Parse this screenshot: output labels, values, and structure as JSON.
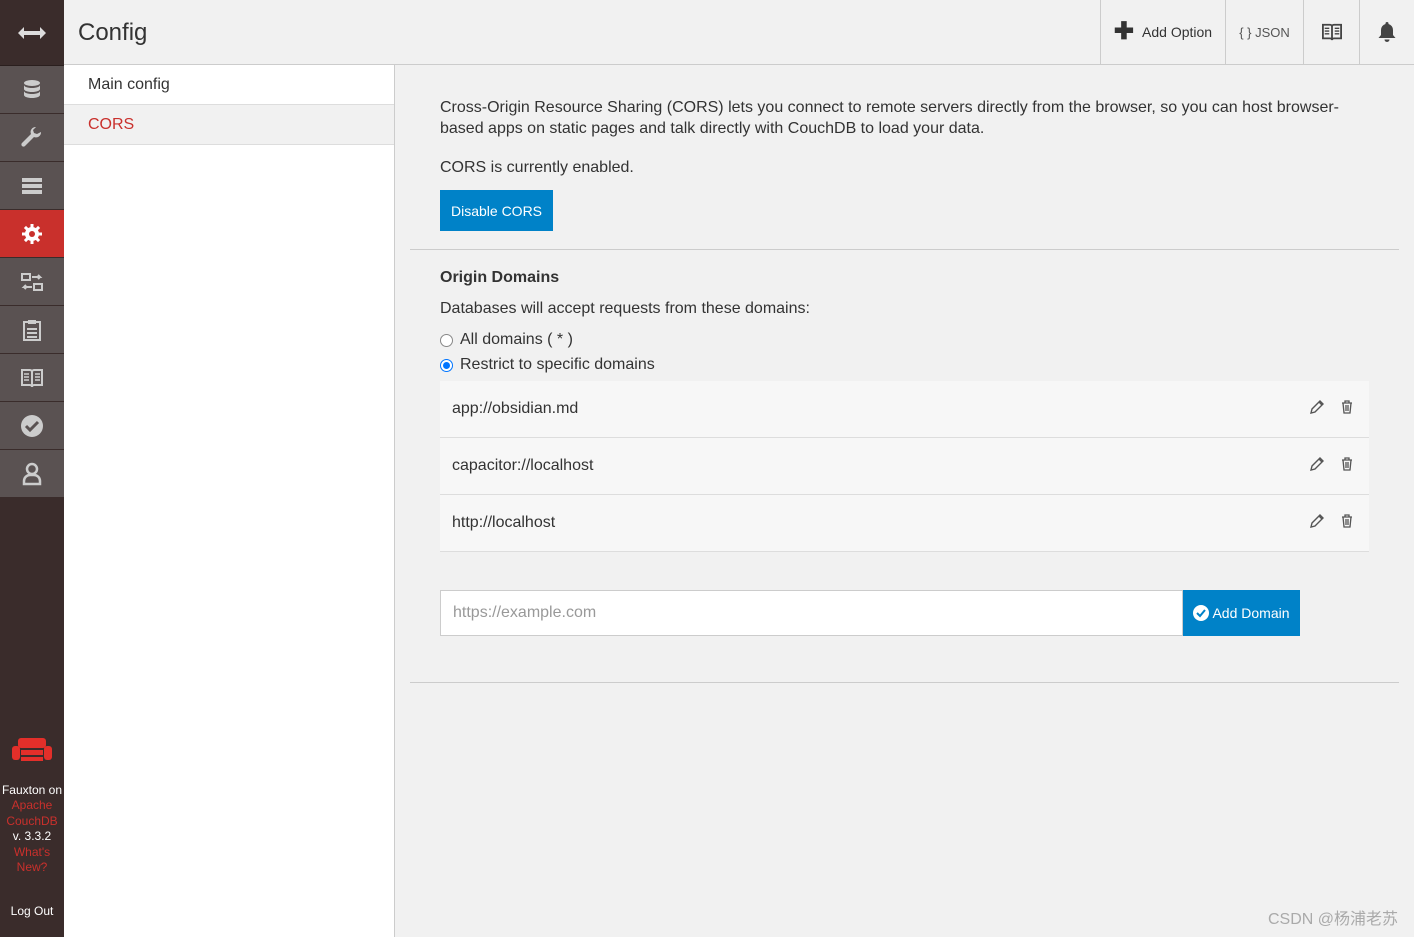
{
  "header": {
    "title": "Config",
    "add_option": "Add Option",
    "json": "{ } JSON"
  },
  "nav": {
    "items": [
      "databases-icon",
      "setup-icon",
      "active-tasks-icon",
      "config-icon",
      "replication-icon",
      "logs-icon",
      "documentation-icon",
      "verify-icon",
      "user-icon"
    ],
    "active": "config-icon"
  },
  "footer": {
    "fauxton_on": "Fauxton on",
    "apache": "Apache",
    "couchdb": "CouchDB",
    "version": "v. 3.3.2",
    "whats": "What's",
    "new": "New?",
    "logout": "Log Out"
  },
  "sidebar": {
    "items": [
      {
        "label": "Main config"
      },
      {
        "label": "CORS"
      }
    ]
  },
  "main": {
    "intro": "Cross-Origin Resource Sharing (CORS) lets you connect to remote servers directly from the browser, so you can host browser-based apps on static pages and talk directly with CouchDB to load your data.",
    "status": "CORS is currently enabled.",
    "disable_button": "Disable CORS",
    "origin_title": "Origin Domains",
    "origin_desc": "Databases will accept requests from these domains:",
    "radio_all": "All domains ( * )",
    "radio_restrict": "Restrict to specific domains",
    "domains": [
      {
        "url": "app://obsidian.md"
      },
      {
        "url": "capacitor://localhost"
      },
      {
        "url": "http://localhost"
      }
    ],
    "input_placeholder": "https://example.com",
    "add_domain_button": "Add Domain"
  },
  "watermark": "CSDN @杨浦老苏",
  "colors": {
    "accent_red": "#c9302c",
    "primary_blue": "#0082c8",
    "nav_dark": "#3a2c2b",
    "nav_item": "#5a5252"
  }
}
